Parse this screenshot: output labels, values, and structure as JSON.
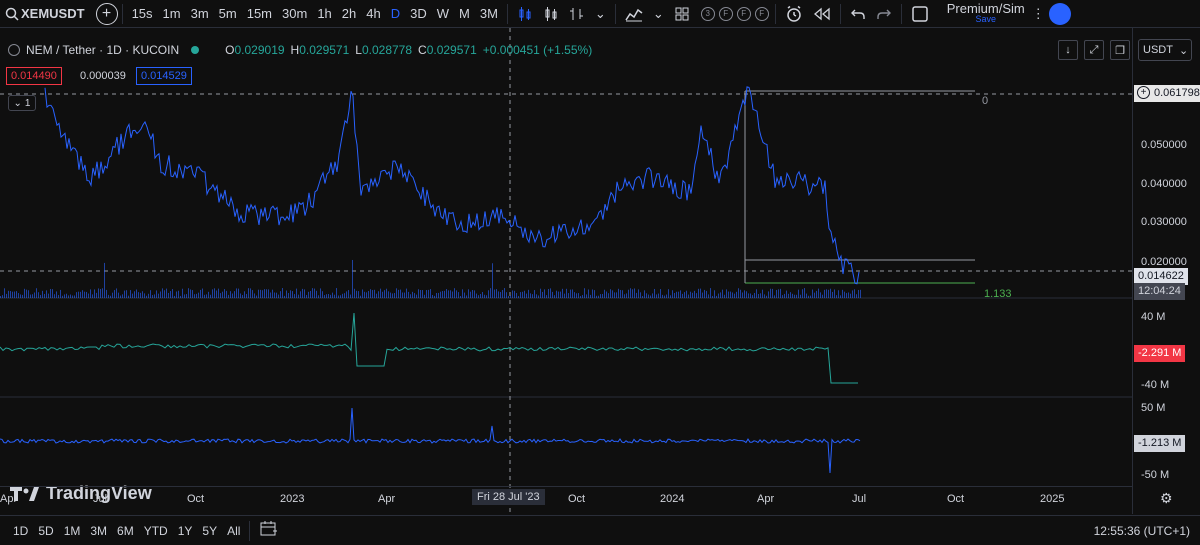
{
  "toolbar": {
    "symbol": "XEMUSDT",
    "intervals": [
      "15s",
      "1m",
      "3m",
      "5m",
      "15m",
      "30m",
      "1h",
      "2h",
      "4h",
      "D",
      "3D",
      "W",
      "M",
      "3M"
    ],
    "active_interval": "D",
    "indicator_pills": [
      "3",
      "F",
      "F",
      "F"
    ],
    "account_label": "Premium/Sim",
    "account_sub": "Save",
    "icons": [
      "search-icon",
      "add-icon",
      "candles-icon",
      "bars-icon",
      "indicators-icon",
      "layout-icon",
      "alert-icon",
      "replay-icon",
      "undo-icon",
      "redo-icon",
      "fullscreen-icon"
    ]
  },
  "legend": {
    "title": "NEM / Tether · 1D · KUCOIN",
    "o_label": "O",
    "o_value": "0.029019",
    "h_label": "H",
    "h_value": "0.029571",
    "l_label": "L",
    "l_value": "0.028778",
    "c_label": "C",
    "c_value": "0.029571",
    "change": "+0.000451 (+1.55%)",
    "bid": "0.014490",
    "spread": "0.000039",
    "ask": "0.014529",
    "pane_toggle": "1"
  },
  "price_axis": {
    "currency": "USDT",
    "ticks": [
      "0.050000",
      "0.040000",
      "0.030000",
      "0.020000"
    ],
    "crosshair_price": "0.061798",
    "last_price": "0.014622",
    "countdown": "12:04:24",
    "line_label_zero": "0",
    "line_label_ratio": "1.133"
  },
  "pane2": {
    "ticks": [
      "40 M",
      "-40 M"
    ],
    "value": "-2.291 M"
  },
  "pane3": {
    "ticks": [
      "50 M",
      "-50 M"
    ],
    "value": "-1.213 M"
  },
  "time_axis": {
    "labels": [
      "Apr",
      "Jul",
      "Oct",
      "2023",
      "Apr",
      "Fri 28 Jul '23",
      "Oct",
      "2024",
      "Apr",
      "Jul",
      "Oct",
      "2025"
    ]
  },
  "bottom_bar": {
    "ranges": [
      "1D",
      "5D",
      "1M",
      "3M",
      "6M",
      "YTD",
      "1Y",
      "5Y",
      "All"
    ],
    "clock": "12:55:36 (UTC+1)"
  },
  "watermark": "TradingView",
  "colors": {
    "price_line": "#2962ff",
    "up": "#26a69a",
    "down": "#f23645",
    "volume": "#2962ff"
  }
}
